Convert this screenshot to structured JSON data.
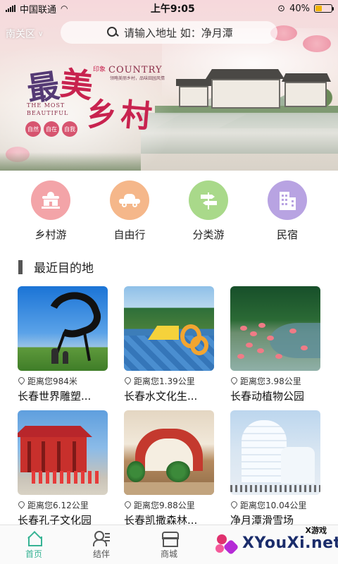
{
  "status_bar": {
    "carrier": "中国联通",
    "time": "上午9:05",
    "battery": "40%",
    "battery_level": 0.4
  },
  "header": {
    "district": "南关区",
    "search_placeholder": "请输入地址 如：净月潭"
  },
  "banner": {
    "title_chars": [
      "最",
      "美",
      "乡",
      "村"
    ],
    "en_word": "COUNTRY",
    "cn_small": "印象",
    "en_line1": "THE MOST",
    "en_line2": "BEAUTIFUL",
    "sub_text": "领略美丽乡村，品味田园风情",
    "stamps": [
      "自然",
      "自在",
      "自我"
    ]
  },
  "categories": [
    {
      "label": "乡村游",
      "icon": "temple-icon",
      "color": "#f3a4a8"
    },
    {
      "label": "自由行",
      "icon": "car-icon",
      "color": "#f5b78a"
    },
    {
      "label": "分类游",
      "icon": "signpost-icon",
      "color": "#a9d98a"
    },
    {
      "label": "民宿",
      "icon": "building-icon",
      "color": "#b8a3e2"
    }
  ],
  "section": {
    "title": "最近目的地"
  },
  "destinations": [
    {
      "distance": "距离您984米",
      "name": "长春世界雕塑..."
    },
    {
      "distance": "距离您1.39公里",
      "name": "长春水文化生..."
    },
    {
      "distance": "距离您3.98公里",
      "name": "长春动植物公园"
    },
    {
      "distance": "距离您6.12公里",
      "name": "长春孔子文化园"
    },
    {
      "distance": "距离您9.88公里",
      "name": "长春凯撒森林..."
    },
    {
      "distance": "距离您10.04公里",
      "name": "净月潭滑雪场"
    }
  ],
  "tabs": [
    {
      "label": "首页",
      "icon": "home-icon",
      "active": true
    },
    {
      "label": "结伴",
      "icon": "partner-icon",
      "active": false
    },
    {
      "label": "商城",
      "icon": "shop-icon",
      "active": false
    }
  ],
  "watermark": {
    "small": "X游戏",
    "text": "XYouXi.net"
  },
  "colors": {
    "accent": "#37b394",
    "banner_red": "#c8234f"
  }
}
